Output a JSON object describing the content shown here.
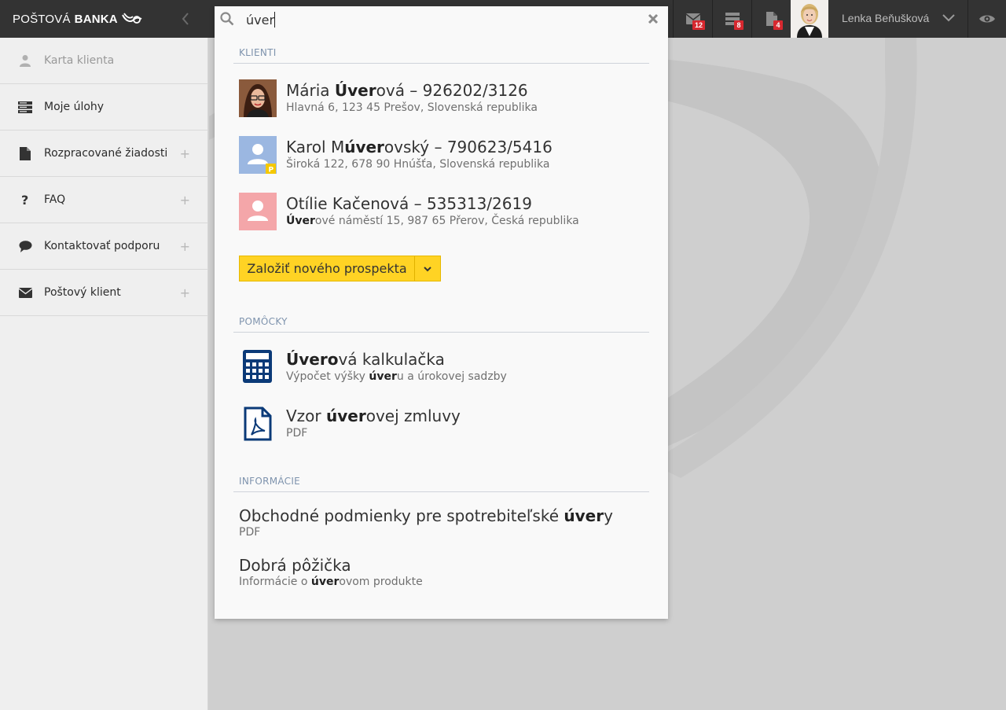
{
  "topbar": {
    "logo_part1": "POŠTOVÁ",
    "logo_part2": "BANKA",
    "badges": {
      "messages": "12",
      "tasks": "8",
      "documents": "4"
    },
    "user_name": "Lenka Beňušková"
  },
  "sidebar": {
    "items": [
      {
        "label": "Karta klienta",
        "icon": "user-icon",
        "disabled": true
      },
      {
        "label": "Moje úlohy",
        "icon": "tasks-icon"
      },
      {
        "label": "Rozpracované žiadosti",
        "icon": "document-icon",
        "plus": "+"
      },
      {
        "label": "FAQ",
        "icon": "question-icon",
        "plus": "+"
      },
      {
        "label": "Kontaktovať podporu",
        "icon": "chat-icon",
        "plus": "+"
      },
      {
        "label": "Poštový klient",
        "icon": "envelope-icon",
        "plus": "+"
      }
    ]
  },
  "search": {
    "query": "úver",
    "sections": {
      "clients": "KLIENTI",
      "tools": "POMÔCKY",
      "info": "INFORMÁCIE"
    },
    "clients": [
      {
        "name_pre": "Mária ",
        "name_hl": "Úver",
        "name_post": "ová – 926202/3126",
        "address_pre": "",
        "address_hl": "",
        "address_post": "Hlavná 6, 123 45 Prešov, Slovenská republika"
      },
      {
        "name_pre": "Karol M",
        "name_hl": "úver",
        "name_post": "ovský – 790623/5416",
        "address_pre": "",
        "address_hl": "",
        "address_post": "Široká 122, 678 90 Hnúšťa, Slovenská republika",
        "badge": "P"
      },
      {
        "name_pre": "Otílie Kačenová – 535313/2619",
        "name_hl": "",
        "name_post": "",
        "address_pre": "",
        "address_hl": "Úver",
        "address_post": "ové náměstí 15, 987 65 Přerov, Česká republika"
      }
    ],
    "new_prospect_label": "Založiť nového prospekta",
    "tools": [
      {
        "title_pre": "",
        "title_hl": "Úvero",
        "title_post": "vá kalkulačka",
        "sub_pre": "Výpočet výšky ",
        "sub_hl": "úver",
        "sub_post": "u a úrokovej sadzby",
        "icon": "calculator-icon"
      },
      {
        "title_pre": "Vzor ",
        "title_hl": "úver",
        "title_post": "ovej zmluvy",
        "sub_pre": "PDF",
        "sub_hl": "",
        "sub_post": "",
        "icon": "pdf-icon"
      }
    ],
    "info": [
      {
        "title_pre": "Obchodné podmienky pre spotrebiteľské ",
        "title_hl": "úver",
        "title_post": "y",
        "sub_pre": "PDF",
        "sub_hl": "",
        "sub_post": ""
      },
      {
        "title_pre": "Dobrá pôžička",
        "title_hl": "",
        "title_post": "",
        "sub_pre": "Informácie o ",
        "sub_hl": "úver",
        "sub_post": "ovom produkte"
      }
    ]
  },
  "colors": {
    "topbar": "#333333",
    "accent_yellow": "#ffd324",
    "badge_red": "#d7282f",
    "section_title": "#7e93ad",
    "navy_icon": "#0b3a78"
  }
}
